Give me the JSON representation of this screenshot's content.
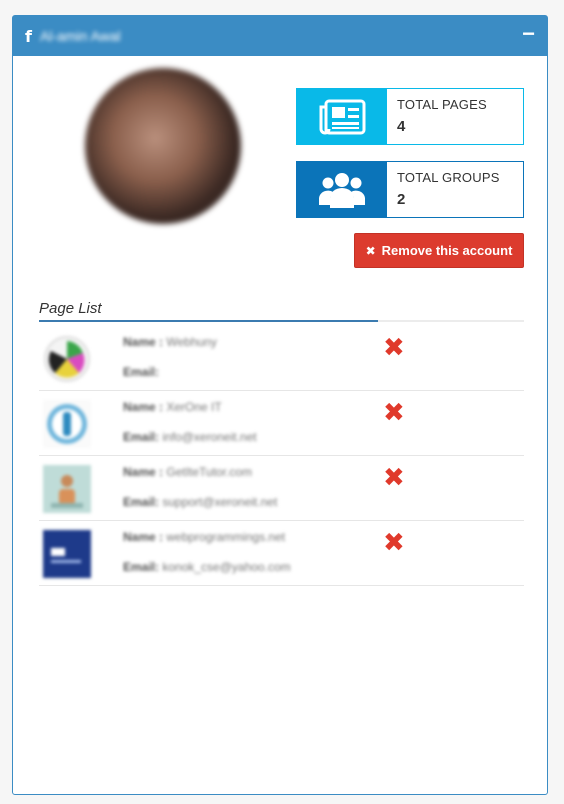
{
  "header": {
    "fb_glyph": "f",
    "title": "Al-amin Awal",
    "collapse_glyph": "−"
  },
  "profile": {
    "avatar_desc": "profile-photo"
  },
  "stats": [
    {
      "label": "TOTAL PAGES",
      "value": "4",
      "icon": "newspaper-icon",
      "color": "#09b9e8"
    },
    {
      "label": "TOTAL GROUPS",
      "value": "2",
      "icon": "users-icon",
      "color": "#0b74b9"
    }
  ],
  "actions": {
    "remove_label": "Remove this account",
    "remove_glyph": "✖"
  },
  "page_list": {
    "title": "Page List",
    "name_label": "Name :",
    "email_label": "Email:",
    "items": [
      {
        "name": "Webhuny",
        "email": ""
      },
      {
        "name": "XerOne IT",
        "email": "info@xeroneit.net"
      },
      {
        "name": "GetIteTutor.com",
        "email": "support@xeroneit.net"
      },
      {
        "name": "webprogrammings.net",
        "email": "konok_cse@yahoo.com"
      }
    ],
    "delete_glyph": "✖"
  },
  "colors": {
    "primary": "#3b8cc4",
    "danger": "#dc3b2e",
    "stat_pages": "#09b9e8",
    "stat_groups": "#0b74b9"
  }
}
